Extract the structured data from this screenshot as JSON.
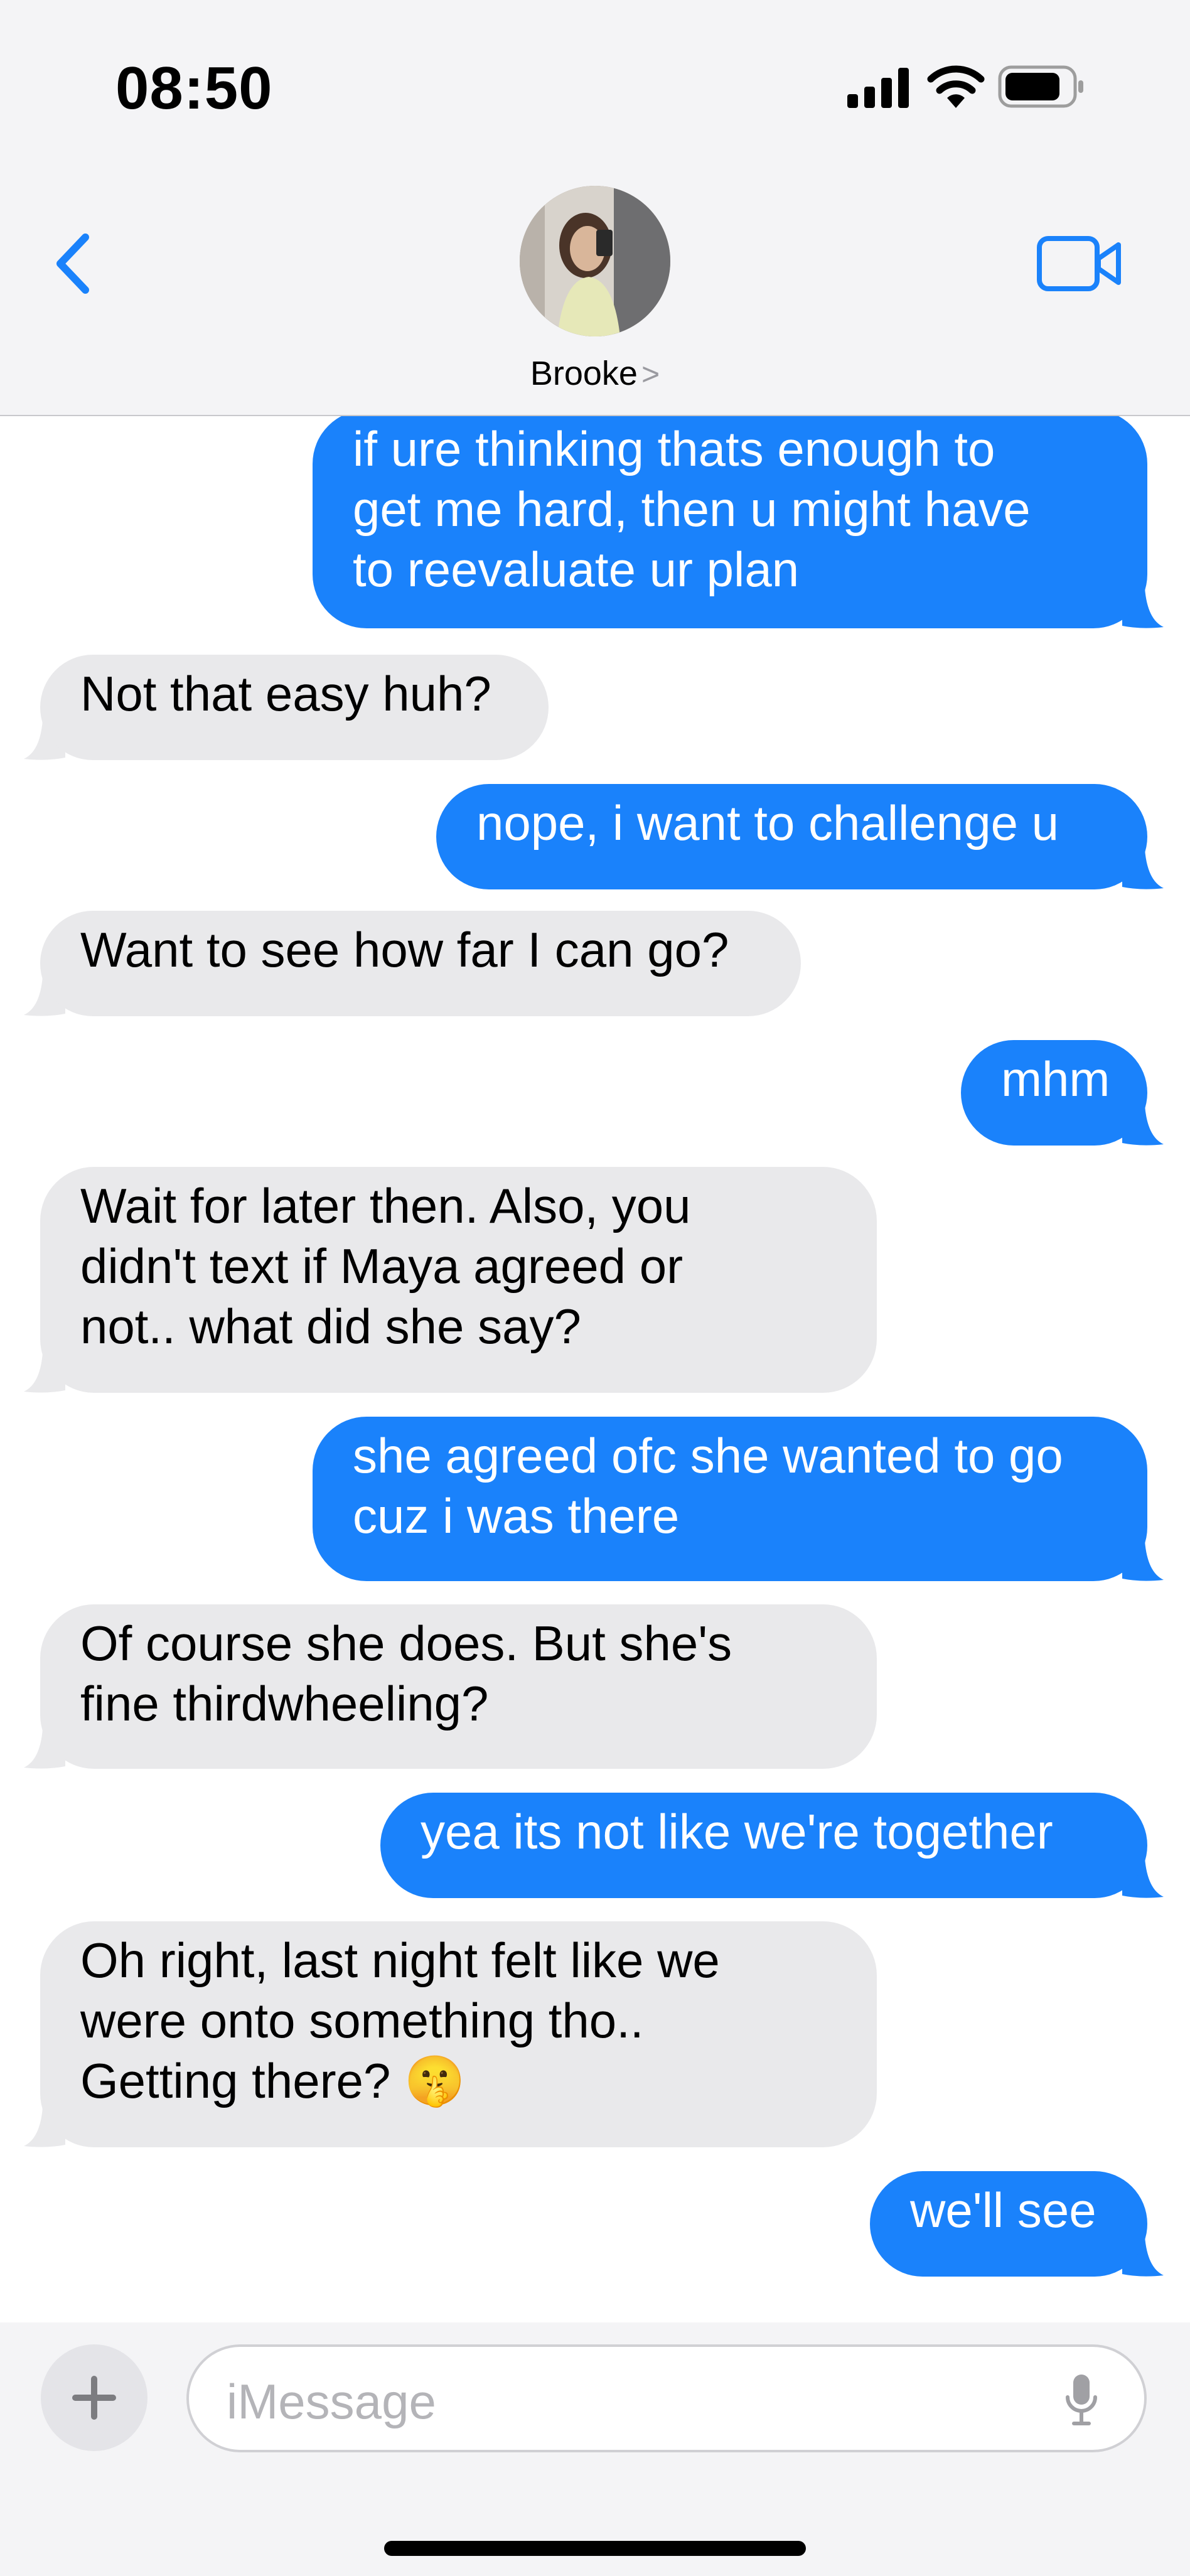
{
  "status_bar": {
    "time": "08:50"
  },
  "header": {
    "contact_name": "Brooke",
    "chevron": ">"
  },
  "icons": {
    "back": "chevron-left-icon",
    "video": "video-camera-icon",
    "plus": "plus-icon",
    "mic": "microphone-icon"
  },
  "colors": {
    "sent_bubble": "#1a82fb",
    "received_bubble": "#e9e9eb",
    "accent": "#1a82fb"
  },
  "messages": [
    {
      "direction": "sent",
      "text": "if ure thinking thats enough to\nget me hard, then u might have\nto reevaluate ur plan"
    },
    {
      "direction": "received",
      "text": "Not that easy huh?"
    },
    {
      "direction": "sent",
      "text": "nope, i want to challenge u"
    },
    {
      "direction": "received",
      "text": "Want to see how far I can go?"
    },
    {
      "direction": "sent",
      "text": "mhm"
    },
    {
      "direction": "received",
      "text": "Wait for later then. Also, you\ndidn't text if Maya agreed or\nnot.. what did she say?"
    },
    {
      "direction": "sent",
      "text": "she agreed ofc she wanted to go\ncuz i was there"
    },
    {
      "direction": "received",
      "text": "Of course she does. But she's\nfine thirdwheeling?"
    },
    {
      "direction": "sent",
      "text": "yea its not like we're together"
    },
    {
      "direction": "received",
      "text": "Oh right, last night felt like we\nwere onto something tho..\nGetting there? 🤫"
    },
    {
      "direction": "sent",
      "text": "we'll see"
    }
  ],
  "composer": {
    "placeholder": "iMessage"
  }
}
